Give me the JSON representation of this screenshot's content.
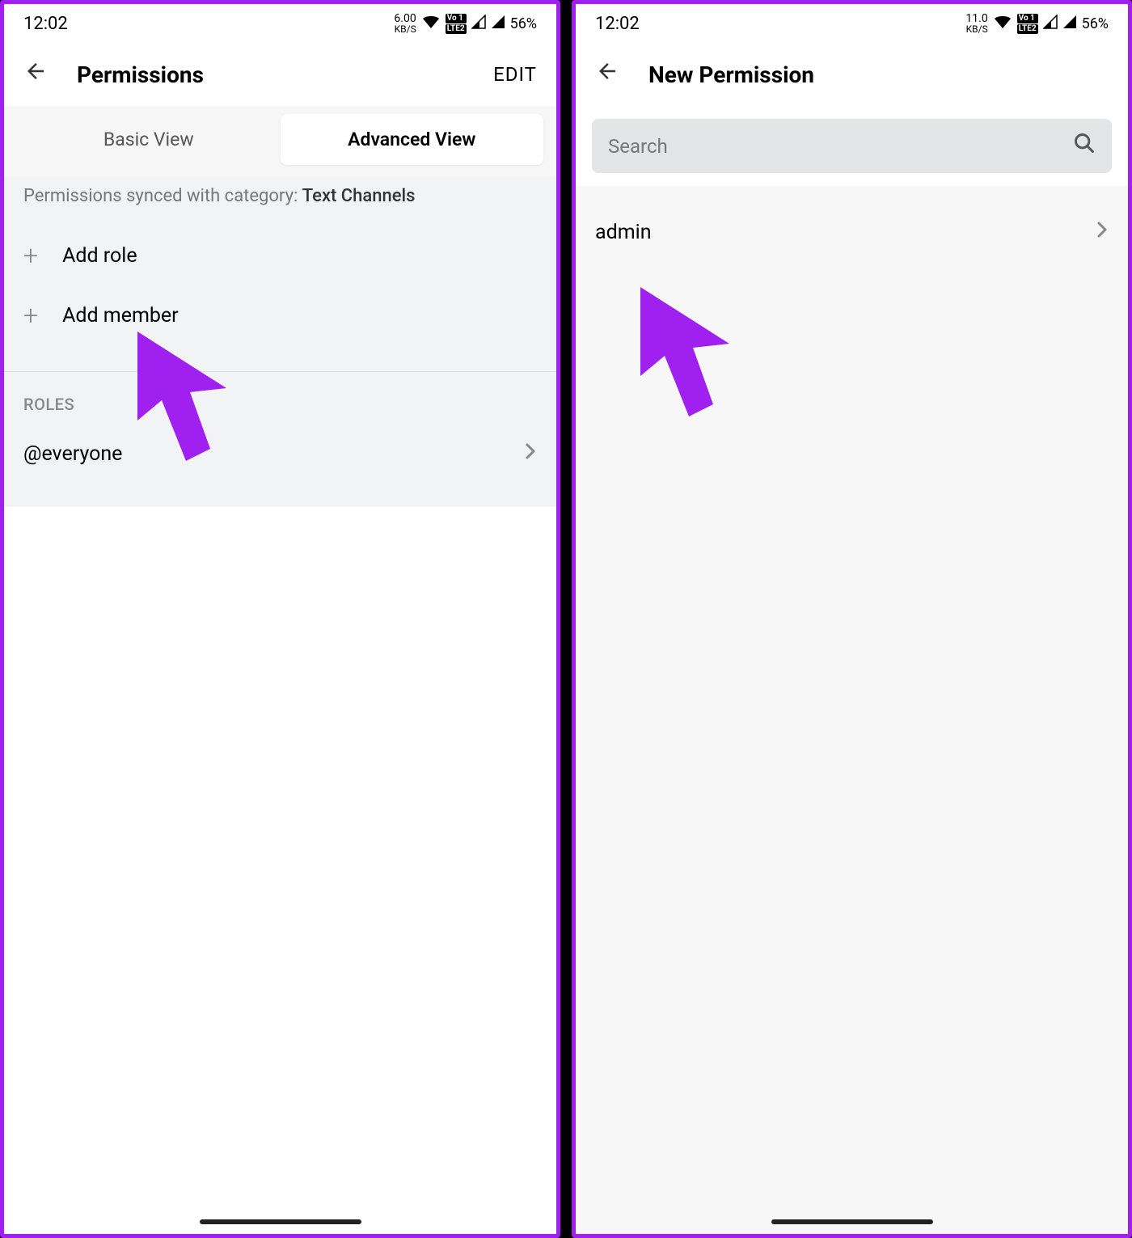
{
  "screen1": {
    "status": {
      "time": "12:02",
      "kbs": "6.00",
      "kbs_unit": "KB/S",
      "battery": "56%"
    },
    "header": {
      "title": "Permissions",
      "edit": "EDIT"
    },
    "tabs": {
      "basic": "Basic View",
      "advanced": "Advanced View"
    },
    "sync_prefix": "Permissions synced with category: ",
    "sync_category": "Text Channels",
    "add_role": "Add role",
    "add_member": "Add member",
    "roles_header": "ROLES",
    "role_everyone": "@everyone"
  },
  "screen2": {
    "status": {
      "time": "12:02",
      "kbs": "11.0",
      "kbs_unit": "KB/S",
      "battery": "56%"
    },
    "header": {
      "title": "New Permission"
    },
    "search_placeholder": "Search",
    "result": "admin"
  }
}
